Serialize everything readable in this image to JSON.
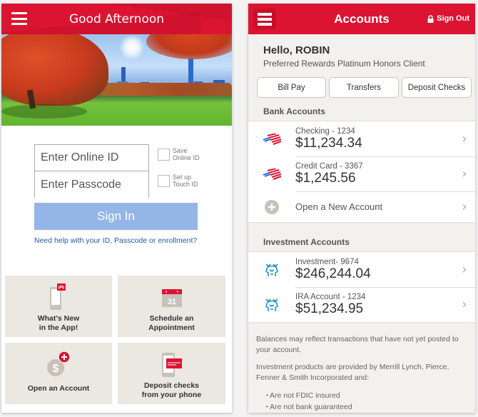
{
  "login_screen": {
    "header": {
      "title": "Good Afternoon",
      "menu_icon": "hamburger-icon"
    },
    "hero_image": {
      "description": "autumn park with city skyline"
    },
    "form": {
      "online_id_placeholder": "Enter Online ID",
      "passcode_placeholder": "Enter Passcode",
      "save_online_id_label": "Save\nOnline ID",
      "touch_id_label": "Set up\nTouch ID",
      "sign_in_label": "Sign In",
      "help_link": "Need help with your ID, Passcode  or enrollment?"
    },
    "tiles": [
      {
        "label": "What's New\nin the App!",
        "icon": "phone-news-icon"
      },
      {
        "label": "Schedule an\nAppointment",
        "icon": "calendar-icon",
        "calendar_day": "31"
      },
      {
        "label": "Open an Account",
        "icon": "dollar-plus-icon",
        "glyph": "$"
      },
      {
        "label": "Deposit checks\nfrom your phone",
        "icon": "phone-check-icon"
      }
    ]
  },
  "accounts_screen": {
    "header": {
      "title": "Accounts",
      "sign_out_label": "Sign Out",
      "menu_icon": "hamburger-icon",
      "lock_icon": "lock-icon"
    },
    "greeting": "Hello, ROBIN",
    "tier": "Preferred Rewards Platinum Honors Client",
    "quick_actions": [
      "Bill Pay",
      "Transfers",
      "Deposit Checks"
    ],
    "bank_section_title": "Bank Accounts",
    "bank_accounts": [
      {
        "name": "Checking - 1234",
        "balance": "$11,234.34",
        "icon": "bofa-flag-icon"
      },
      {
        "name": "Credit Card - 3367",
        "balance": "$1,245.56",
        "icon": "bofa-flag-icon"
      }
    ],
    "open_account_label": "Open a New Account",
    "investment_section_title": "Investment Accounts",
    "investment_accounts": [
      {
        "name": "Investment- 9674",
        "balance": "$246,244.04",
        "icon": "merrill-bull-icon"
      },
      {
        "name": "IRA Account - 1234",
        "balance": "$51,234.95",
        "icon": "merrill-bull-icon"
      }
    ],
    "disclaimer": {
      "balances_note": "Balances may reflect transactions that have not yet posted to your account.",
      "investment_note": "Investment products are provided by Merrill Lynch, Pierce, Fenner & Smith Incorporated and:",
      "bullets": [
        "Are not FDIC insured",
        "Are not bank guaranteed"
      ]
    }
  },
  "colors": {
    "brand_red": "#dc1431",
    "sign_in_blue": "#93b6e6",
    "link_blue": "#1a5ea8",
    "tile_beige": "#ebe7e1",
    "merrill_blue": "#1e8fd6"
  }
}
